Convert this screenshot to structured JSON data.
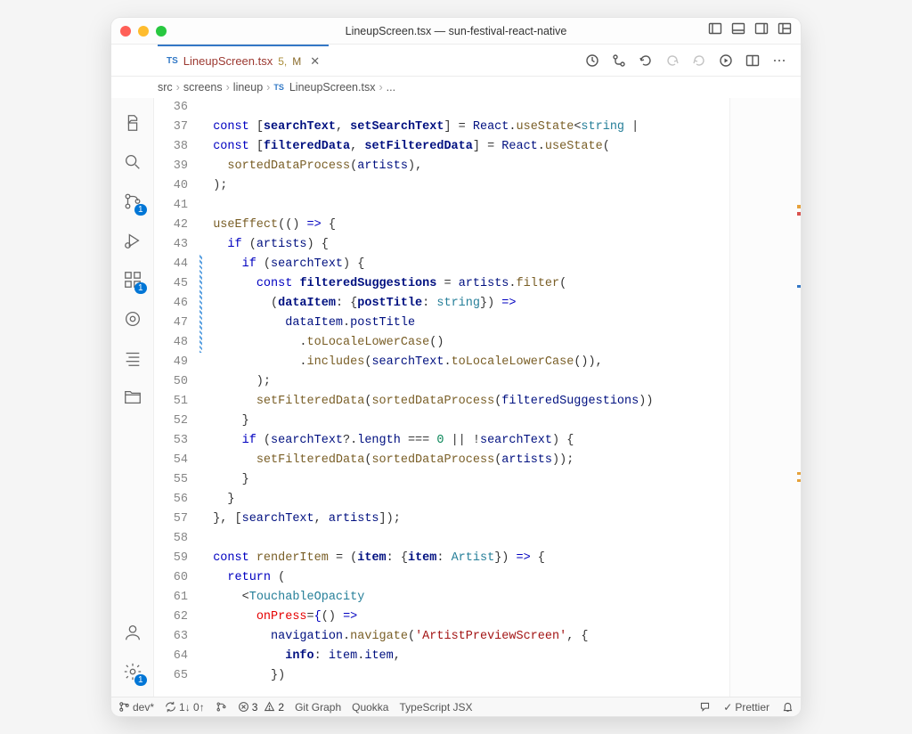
{
  "window": {
    "title": "LineupScreen.tsx — sun-festival-react-native"
  },
  "tab": {
    "ts_badge": "TS",
    "filename": "LineupScreen.tsx",
    "problem_count": "5,",
    "modified": "M"
  },
  "breadcrumb": {
    "parts": [
      "src",
      "screens",
      "lineup"
    ],
    "ts_badge": "TS",
    "file": "LineupScreen.tsx",
    "trail": "..."
  },
  "activity": {
    "scm_badge": "1",
    "extensions_badge": "1",
    "settings_badge": "1"
  },
  "gutter": {
    "start": 36,
    "end": 65
  },
  "code_lines": [
    "",
    "  <kw>const</kw> [<var>searchText</var>, <var>setSearchText</var>] = <var2>React</var2>.<fn>useState</fn>&lt;<type>string</type> | ",
    "  <kw>const</kw> [<var>filteredData</var>, <var>setFilteredData</var>] = <var2>React</var2>.<fn>useState</fn>(",
    "    <fn>sortedDataProcess</fn>(<var2>artists</var2>),",
    "  );",
    "",
    "  <fn>useEffect</fn>(() <kw2>=&gt;</kw2> {",
    "    <kw>if</kw> (<var2>artists</var2>) {",
    "      <kw>if</kw> (<var2>searchText</var2>) {",
    "        <kw>const</kw> <var>filteredSuggestions</var> = <var2>artists</var2>.<fn>filter</fn>(",
    "          (<var>dataItem</var>: {<var>postTitle</var>: <type>string</type>}) <kw2>=&gt;</kw2>",
    "            <var2>dataItem</var2>.<prop>postTitle</prop>",
    "              .<fn>toLocaleLowerCase</fn>()",
    "              .<fn>includes</fn>(<var2>searchText</var2>.<fn>toLocaleLowerCase</fn>()),",
    "        );",
    "        <fn>setFilteredData</fn>(<fn>sortedDataProcess</fn>(<var2>filteredSuggestions</var2>))",
    "      }",
    "      <kw>if</kw> (<var2>searchText</var2>?.<prop>length</prop> === <num>0</num> || !<var2>searchText</var2>) {",
    "        <fn>setFilteredData</fn>(<fn>sortedDataProcess</fn>(<var2>artists</var2>));",
    "      }",
    "    }",
    "  }, [<var2>searchText</var2>, <var2>artists</var2>]);",
    "",
    "  <kw>const</kw> <fn>renderItem</fn> = (<var>item</var>: {<var>item</var>: <type>Artist</type>}) <kw2>=&gt;</kw2> {",
    "    <kw>return</kw> (",
    "      &lt;<tag>TouchableOpacity</tag>",
    "        <attr>onPress</attr>=<jsx>{</jsx>() <kw2>=&gt;</kw2>",
    "          <var2>navigation</var2>.<fn>navigate</fn>(<str>'ArtistPreviewScreen'</str>, {",
    "            <var>info</var>: <var2>item</var2>.<prop>item</prop>,",
    "          })"
  ],
  "statusbar": {
    "branch": "dev*",
    "sync": "1↓ 0↑",
    "errors": "3",
    "warnings": "2",
    "items": [
      "Git Graph",
      "Quokka",
      "TypeScript JSX"
    ],
    "formatter": "Prettier"
  }
}
